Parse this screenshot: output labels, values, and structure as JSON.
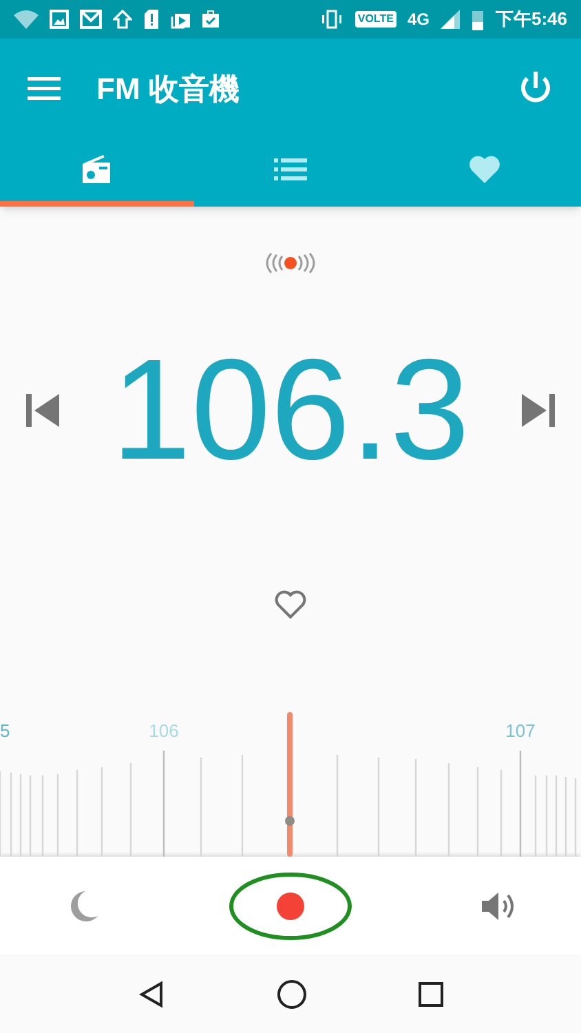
{
  "status_bar": {
    "network_badge": "VOLTE",
    "network_type": "4G",
    "time": "下午5:46"
  },
  "app_bar": {
    "title": "FM 收音機"
  },
  "tabs": [
    {
      "kind": "radio",
      "selected": true
    },
    {
      "kind": "list",
      "selected": false
    },
    {
      "kind": "heart",
      "selected": false
    }
  ],
  "station": {
    "frequency": "106.3",
    "favorite": false
  },
  "dial": {
    "labels": [
      "5",
      "106",
      "107"
    ]
  },
  "bottom_bar": {
    "record_circled": true
  }
}
